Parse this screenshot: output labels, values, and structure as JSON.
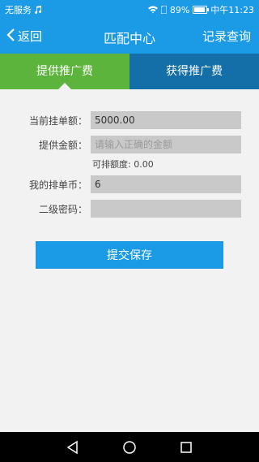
{
  "status_bar": {
    "carrier": "无服务",
    "battery_percent": "89%",
    "battery_level": 0.89,
    "time": "中午11:23"
  },
  "header": {
    "back_label": "返回",
    "title": "匹配中心",
    "records_label": "记录查询"
  },
  "tabs": [
    {
      "label": "提供推广费",
      "active": true
    },
    {
      "label": "获得推广费",
      "active": false
    }
  ],
  "form": {
    "current_order": {
      "label": "当前挂单额：",
      "value": "5000.00"
    },
    "provide_amount": {
      "label": "提供金额：",
      "value": "",
      "placeholder": "请输入正确的金额"
    },
    "available_hint": "可排额度: 0.00",
    "my_coins": {
      "label": "我的排单币：",
      "value": "6"
    },
    "second_password": {
      "label": "二级密码：",
      "value": ""
    },
    "submit_label": "提交保存"
  },
  "colors": {
    "primary": "#1b9be6",
    "tab_active": "#5db43c",
    "tab_inactive": "#146fa8"
  }
}
